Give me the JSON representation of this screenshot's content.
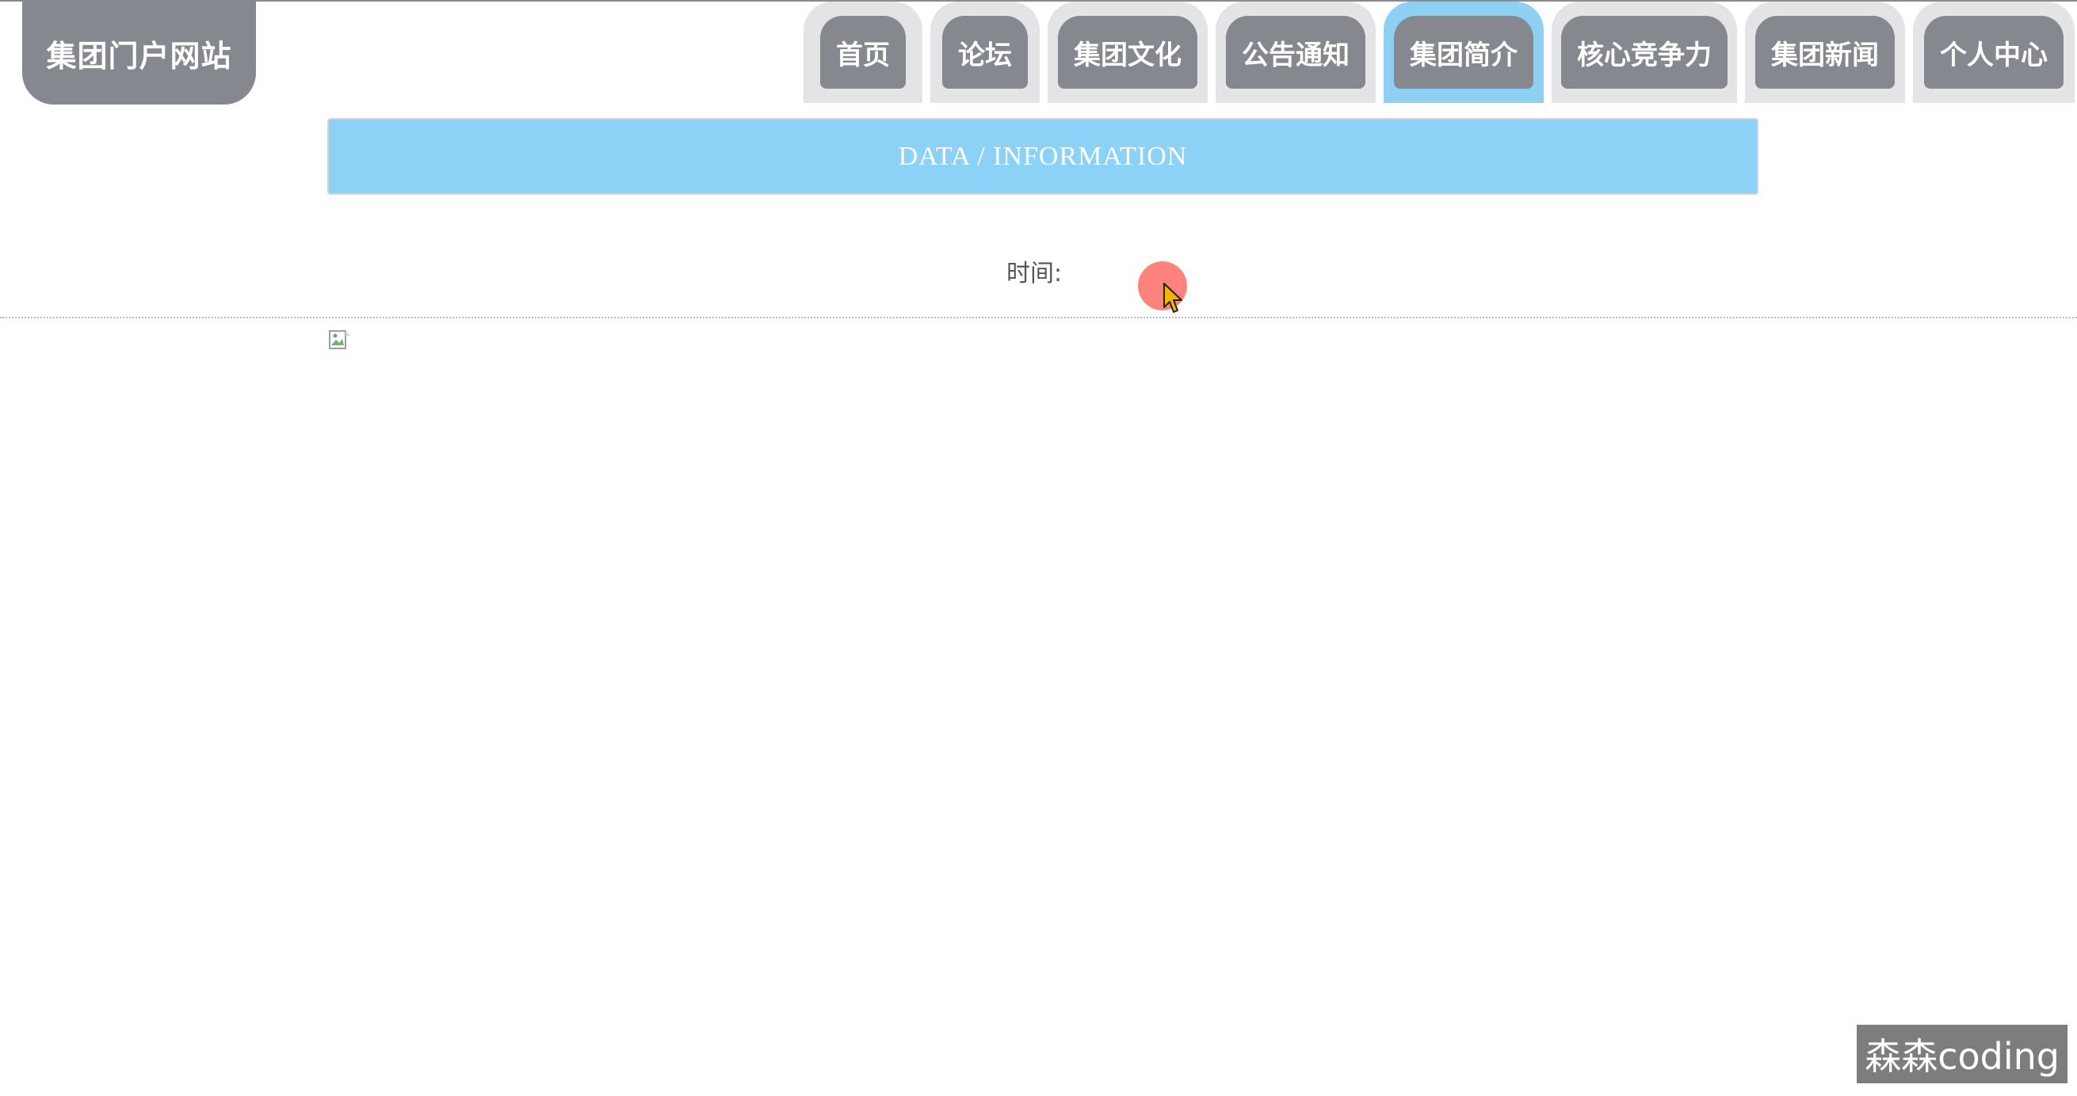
{
  "site": {
    "logo_text": "集团门户网站"
  },
  "nav": {
    "items": [
      {
        "label": "首页",
        "active": false
      },
      {
        "label": "论坛",
        "active": false
      },
      {
        "label": "集团文化",
        "active": false
      },
      {
        "label": "公告通知",
        "active": false
      },
      {
        "label": "集团简介",
        "active": true
      },
      {
        "label": "核心竞争力",
        "active": false
      },
      {
        "label": "集团新闻",
        "active": false
      },
      {
        "label": "个人中心",
        "active": false
      }
    ]
  },
  "banner": {
    "title": "DATA / INFORMATION"
  },
  "article": {
    "time_label": "时间:",
    "image_icon": "broken-image-icon"
  },
  "overlay": {
    "watermark": "森森coding"
  },
  "colors": {
    "nav_pill": "#85888e",
    "nav_active": "#8dd0f3",
    "banner": "#8bd2f6",
    "cursor_highlight": "#ff5a50"
  }
}
